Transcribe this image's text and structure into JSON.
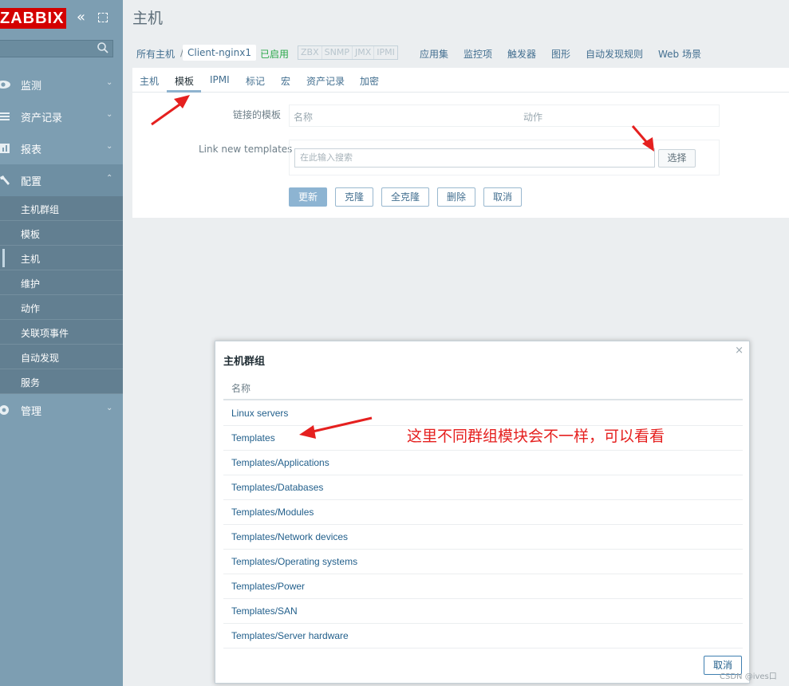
{
  "app": {
    "logo": "ZABBIX",
    "page_title": "主机"
  },
  "sidebar": {
    "menu": [
      {
        "label": "监测",
        "icon": "eye-icon"
      },
      {
        "label": "资产记录",
        "icon": "list-icon"
      },
      {
        "label": "报表",
        "icon": "bar-chart-icon"
      },
      {
        "label": "配置",
        "icon": "wrench-icon"
      },
      {
        "label": "管理",
        "icon": "gear-icon"
      }
    ],
    "config_submenu": [
      "主机群组",
      "模板",
      "主机",
      "维护",
      "动作",
      "关联项事件",
      "自动发现",
      "服务"
    ],
    "selected_submenu": "主机"
  },
  "breadcrumb": {
    "all_hosts": "所有主机",
    "separator": "/",
    "current_host": "Client-nginx1",
    "status": "已启用",
    "protocols": [
      "ZBX",
      "SNMP",
      "JMX",
      "IPMI"
    ],
    "links": [
      "应用集",
      "监控项",
      "触发器",
      "图形",
      "自动发现规则",
      "Web 场景"
    ]
  },
  "tabs": [
    "主机",
    "模板",
    "IPMI",
    "标记",
    "宏",
    "资产记录",
    "加密"
  ],
  "active_tab": "模板",
  "form": {
    "linked_templates_label": "链接的模板",
    "linked_col_name": "名称",
    "linked_col_action": "动作",
    "link_new_label": "Link new templates",
    "search_placeholder": "在此输入搜索",
    "select_button": "选择",
    "buttons": {
      "update": "更新",
      "clone": "克隆",
      "full_clone": "全克隆",
      "delete": "删除",
      "cancel": "取消"
    }
  },
  "modal": {
    "title": "主机群组",
    "column_name": "名称",
    "rows": [
      "Linux servers",
      "Templates",
      "Templates/Applications",
      "Templates/Databases",
      "Templates/Modules",
      "Templates/Network devices",
      "Templates/Operating systems",
      "Templates/Power",
      "Templates/SAN",
      "Templates/Server hardware"
    ],
    "cancel_button": "取消",
    "close_glyph": "×"
  },
  "annotation": {
    "text": "这里不同群组模块会不一样，可以看看",
    "color": "#e5201f"
  },
  "watermark": "CSDN @ives口"
}
